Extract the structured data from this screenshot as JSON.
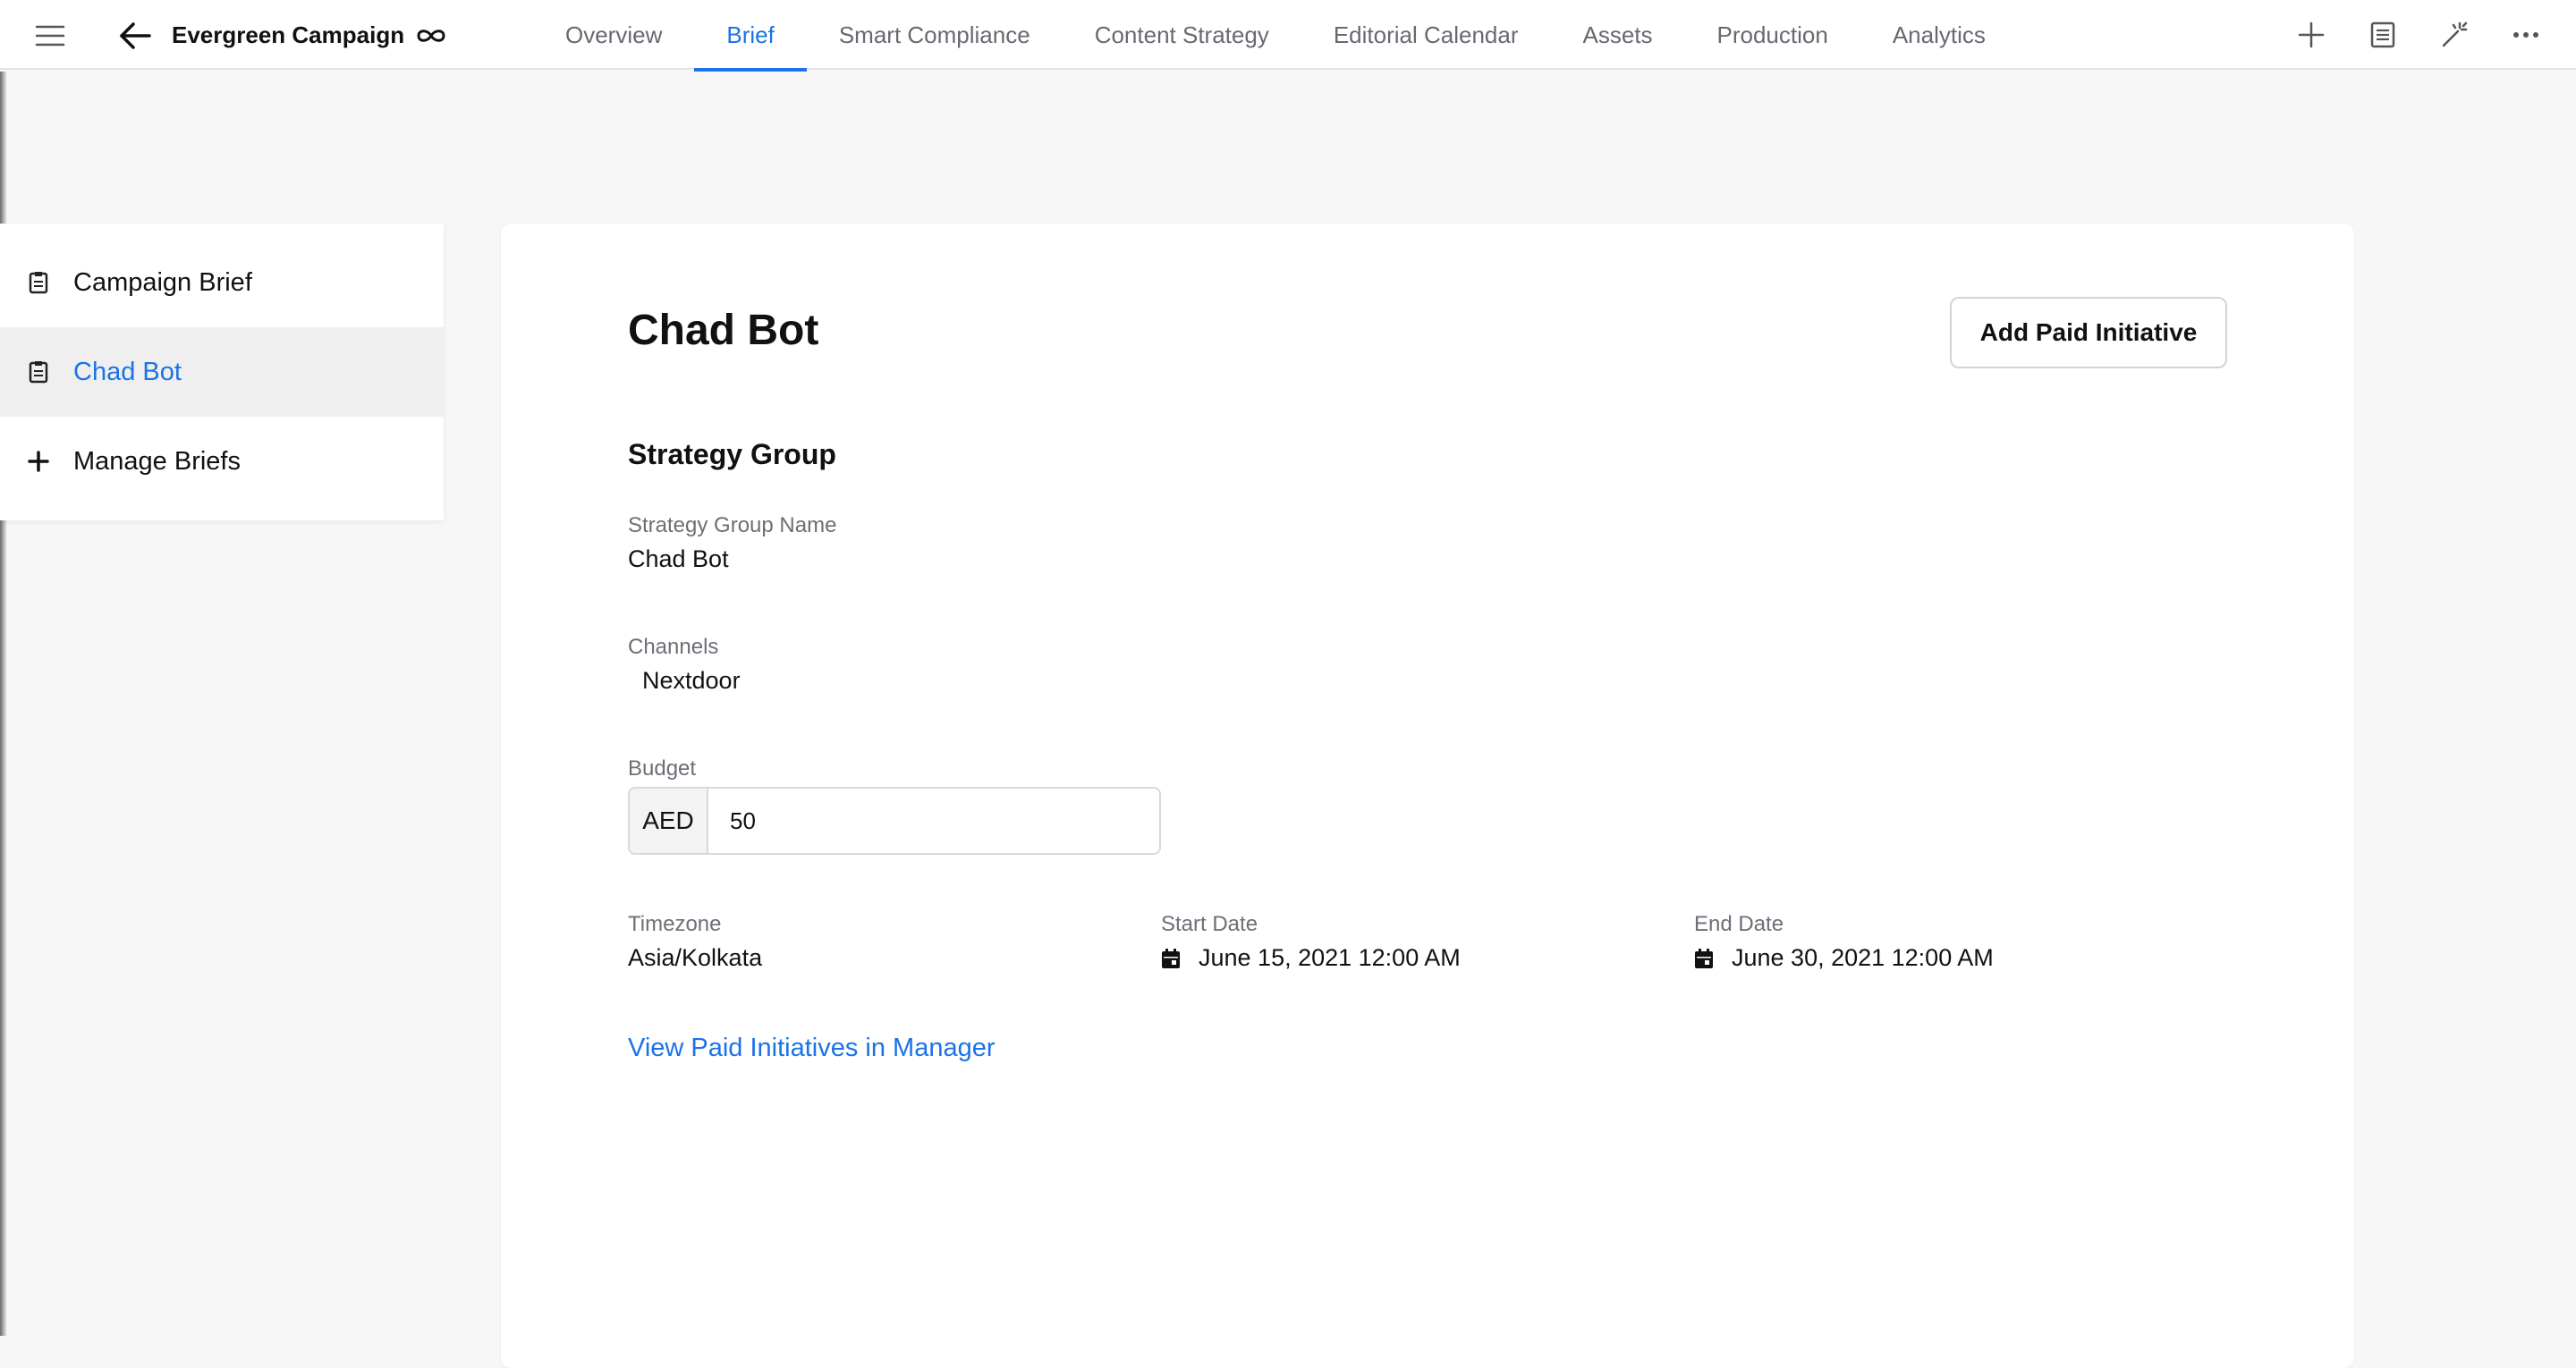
{
  "header": {
    "title": "Evergreen Campaign",
    "tabs": [
      {
        "label": "Overview"
      },
      {
        "label": "Brief"
      },
      {
        "label": "Smart Compliance"
      },
      {
        "label": "Content Strategy"
      },
      {
        "label": "Editorial Calendar"
      },
      {
        "label": "Assets"
      },
      {
        "label": "Production"
      },
      {
        "label": "Analytics"
      }
    ],
    "active_tab": "Brief",
    "icons": [
      "menu-icon",
      "back-icon",
      "infinity-icon",
      "plus-icon",
      "notes-icon",
      "magic-wand-icon",
      "more-icon"
    ]
  },
  "sidebar": {
    "items": [
      {
        "label": "Campaign Brief",
        "icon": "clipboard-icon"
      },
      {
        "label": "Chad Bot",
        "icon": "clipboard-icon",
        "selected": true
      },
      {
        "label": "Manage Briefs",
        "icon": "plus-icon"
      }
    ]
  },
  "main": {
    "title": "Chad Bot",
    "add_button": "Add Paid Initiative",
    "section_title": "Strategy Group",
    "fields": {
      "strategy_group_name": {
        "label": "Strategy Group Name",
        "value": "Chad Bot"
      },
      "channels": {
        "label": "Channels",
        "value": "Nextdoor"
      },
      "budget": {
        "label": "Budget",
        "currency": "AED",
        "value": "50"
      },
      "timezone": {
        "label": "Timezone",
        "value": "Asia/Kolkata"
      },
      "start_date": {
        "label": "Start Date",
        "value": "June 15, 2021 12:00 AM"
      },
      "end_date": {
        "label": "End Date",
        "value": "June 30, 2021 12:00 AM"
      }
    },
    "link": "View Paid Initiatives in Manager"
  },
  "colors": {
    "accent": "#1a73e8",
    "background": "#f7f7f8",
    "card": "#ffffff",
    "muted_text": "#6b6f76"
  }
}
